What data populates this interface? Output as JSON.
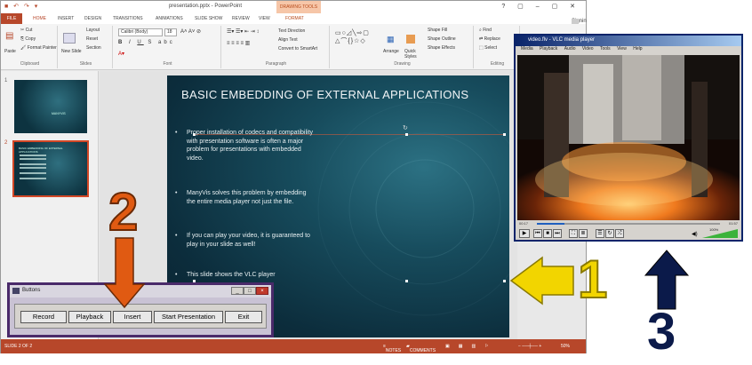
{
  "powerpoint": {
    "title": "presentation.pptx - PowerPoint",
    "tools_tab": "DRAWING TOOLS",
    "user": "Signin",
    "tabs": [
      "FILE",
      "HOME",
      "INSERT",
      "DESIGN",
      "TRANSITIONS",
      "ANIMATIONS",
      "SLIDE SHOW",
      "REVIEW",
      "VIEW",
      "FORMAT"
    ],
    "ribbon_groups": [
      "Clipboard",
      "Slides",
      "Font",
      "Paragraph",
      "Drawing",
      "Editing"
    ],
    "ribbon": {
      "cut": "Cut",
      "copy": "Copy",
      "format_painter": "Format Painter",
      "paste": "Paste",
      "new_slide": "New Slide",
      "layout": "Layout",
      "reset": "Reset",
      "section": "Section",
      "font_name": "Calibri (Body)",
      "font_size": "18",
      "text_direction": "Text Direction",
      "align_text": "Align Text",
      "convert_smartart": "Convert to SmartArt",
      "arrange": "Arrange",
      "quick_styles": "Quick Styles",
      "shape_fill": "Shape Fill",
      "shape_outline": "Shape Outline",
      "shape_effects": "Shape Effects",
      "find": "Find",
      "replace": "Replace",
      "select": "Select"
    },
    "thumbnails": [
      {
        "number": "1",
        "title": "MANYVIS"
      },
      {
        "number": "2",
        "title": "BASIC EMBEDDING OF EXTERNAL APPLICATIONS"
      }
    ],
    "slide": {
      "title": "BASIC EMBEDDING OF EXTERNAL APPLICATIONS",
      "bullets": [
        "Proper installation of codecs and compatibility with presentation software is often a major problem for presentations with embedded video.",
        "ManyVis solves this problem by embedding the entire media player not just the file.",
        "If you can play your video, it is guaranteed to play in your slide as well!",
        "This slide shows the VLC player"
      ]
    },
    "status": {
      "slide_of": "SLIDE 2 OF 2",
      "notes": "NOTES",
      "comments": "COMMENTS",
      "zoom": "50%"
    }
  },
  "vlc": {
    "title": "video.flv - VLC media player",
    "menu": [
      "Media",
      "Playback",
      "Audio",
      "Video",
      "Tools",
      "View",
      "Help"
    ],
    "time_elapsed": "00:17",
    "time_total": "01:57",
    "progress": 0.15,
    "volume": "100%"
  },
  "dialog": {
    "title": "Buttons",
    "buttons": [
      "Record",
      "Playback",
      "Insert",
      "Start Presentation",
      "Exit"
    ]
  },
  "annotations": {
    "n1": "1",
    "n2": "2",
    "n3": "3",
    "colors": {
      "yellow": "#f2d500",
      "orange": "#e05a12",
      "navy": "#0b1a4a"
    }
  }
}
